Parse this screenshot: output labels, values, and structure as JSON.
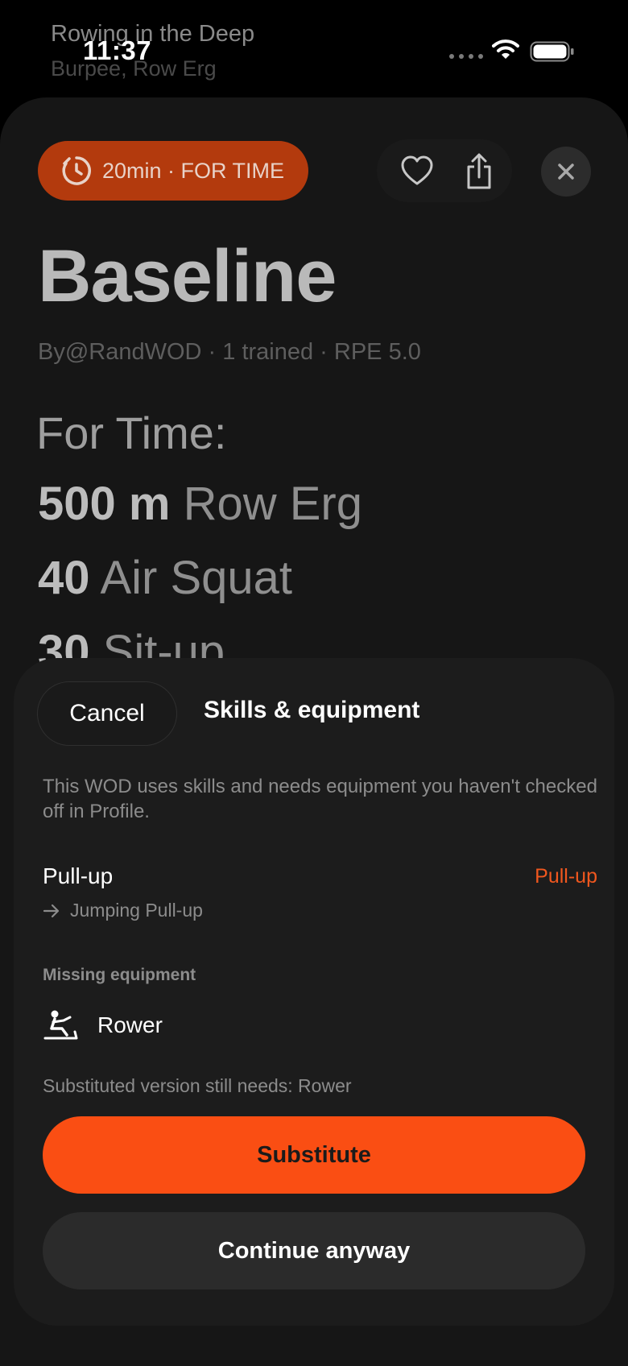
{
  "now_playing": {
    "title": "Rowing in the Deep",
    "subtitle": "Burpee, Row Erg"
  },
  "status_bar": {
    "time": "11:37"
  },
  "workout": {
    "duration_label": "20min · FOR TIME",
    "title": "Baseline",
    "meta": "By@RandWOD · 1 trained · RPE 5.0",
    "format": "For Time:",
    "movements": [
      {
        "amount": "500 m",
        "name": "Row Erg"
      },
      {
        "amount": "40",
        "name": "Air Squat"
      },
      {
        "amount": "30",
        "name": "Sit-up"
      }
    ],
    "accent_color": "#b33a0d"
  },
  "sheet": {
    "cancel_label": "Cancel",
    "title": "Skills & equipment",
    "description": "This WOD uses skills and needs equipment you haven't checked off in Profile.",
    "skill": {
      "name": "Pull-up",
      "tag": "Pull-up",
      "substitute": "Jumping Pull-up"
    },
    "missing_equipment_heading": "Missing equipment",
    "equipment": [
      {
        "name": "Rower",
        "icon": "rower-icon"
      }
    ],
    "still_needs": "Substituted version still needs: Rower",
    "primary_button": "Substitute",
    "secondary_button": "Continue anyway",
    "primary_color": "#fa4e13"
  }
}
